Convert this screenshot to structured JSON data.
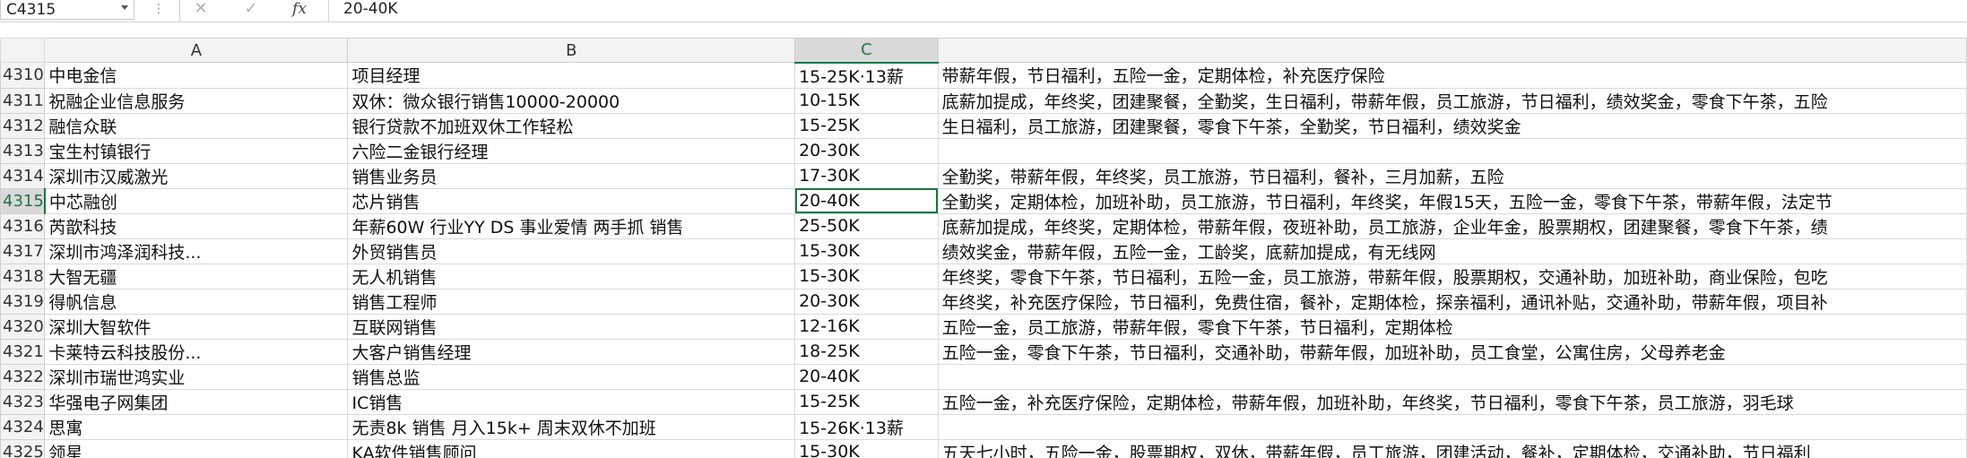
{
  "formula_bar": {
    "name_box": "C4315",
    "cancel_icon": "close-icon",
    "enter_icon": "check-icon",
    "fx_label": "fx",
    "value": "20-40K"
  },
  "columns": [
    "",
    "A",
    "B",
    "C",
    ""
  ],
  "selected_cell": "C4315",
  "rows": [
    {
      "num": "4310",
      "a": "中电金信",
      "b": "项目经理",
      "c": "15-25K·13薪",
      "d": "带薪年假，节日福利，五险一金，定期体检，补充医疗保险"
    },
    {
      "num": "4311",
      "a": "祝融企业信息服务",
      "b": "双休：微众银行销售10000-20000",
      "c": "10-15K",
      "d": "底薪加提成，年终奖，团建聚餐，全勤奖，生日福利，带薪年假，员工旅游，节日福利，绩效奖金，零食下午茶，五险"
    },
    {
      "num": "4312",
      "a": "融信众联",
      "b": "银行贷款不加班双休工作轻松",
      "c": "15-25K",
      "d": "生日福利，员工旅游，团建聚餐，零食下午茶，全勤奖，节日福利，绩效奖金"
    },
    {
      "num": "4313",
      "a": "宝生村镇银行",
      "b": "六险二金银行经理",
      "c": "20-30K",
      "d": ""
    },
    {
      "num": "4314",
      "a": "深圳市汉威激光",
      "b": "销售业务员",
      "c": "17-30K",
      "d": "全勤奖，带薪年假，年终奖，员工旅游，节日福利，餐补，三月加薪，五险"
    },
    {
      "num": "4315",
      "a": "中芯融创",
      "b": "芯片销售",
      "c": "20-40K",
      "d": "全勤奖，定期体检，加班补助，员工旅游，节日福利，年终奖，年假15天，五险一金，零食下午茶，带薪年假，法定节"
    },
    {
      "num": "4316",
      "a": "芮歆科技",
      "b": "年薪60W 行业YY DS 事业爱情 两手抓 销售",
      "c": "25-50K",
      "d": "底薪加提成，年终奖，定期体检，带薪年假，夜班补助，员工旅游，企业年金，股票期权，团建聚餐，零食下午茶，绩"
    },
    {
      "num": "4317",
      "a": "深圳市鸿泽润科技...",
      "b": "外贸销售员",
      "c": "15-30K",
      "d": "绩效奖金，带薪年假，五险一金，工龄奖，底薪加提成，有无线网"
    },
    {
      "num": "4318",
      "a": "大智无疆",
      "b": "无人机销售",
      "c": "15-30K",
      "d": "年终奖，零食下午茶，节日福利，五险一金，员工旅游，带薪年假，股票期权，交通补助，加班补助，商业保险，包吃"
    },
    {
      "num": "4319",
      "a": "得帆信息",
      "b": "销售工程师",
      "c": "20-30K",
      "d": "年终奖，补充医疗保险，节日福利，免费住宿，餐补，定期体检，探亲福利，通讯补贴，交通补助，带薪年假，项目补"
    },
    {
      "num": "4320",
      "a": "深圳大智软件",
      "b": "互联网销售",
      "c": "12-16K",
      "d": "五险一金，员工旅游，带薪年假，零食下午茶，节日福利，定期体检"
    },
    {
      "num": "4321",
      "a": "卡莱特云科技股份...",
      "b": "大客户销售经理",
      "c": "18-25K",
      "d": "五险一金，零食下午茶，节日福利，交通补助，带薪年假，加班补助，员工食堂，公寓住房，父母养老金"
    },
    {
      "num": "4322",
      "a": "深圳市瑞世鸿实业",
      "b": "销售总监",
      "c": "20-40K",
      "d": ""
    },
    {
      "num": "4323",
      "a": "华强电子网集团",
      "b": "IC销售",
      "c": "15-25K",
      "d": "五险一金，补充医疗保险，定期体检，带薪年假，加班补助，年终奖，节日福利，零食下午茶，员工旅游，羽毛球"
    },
    {
      "num": "4324",
      "a": "思寓",
      "b": "无责8k 销售 月入15k+ 周末双休不加班",
      "c": "15-26K·13薪",
      "d": ""
    },
    {
      "num": "4325",
      "a": "领星",
      "b": "KA软件销售顾问",
      "c": "15-30K",
      "d": "五天七小时，五险一金，股票期权，双休，带薪年假，员工旅游，团建活动，餐补，定期体检，交通补助，节日福利"
    }
  ]
}
